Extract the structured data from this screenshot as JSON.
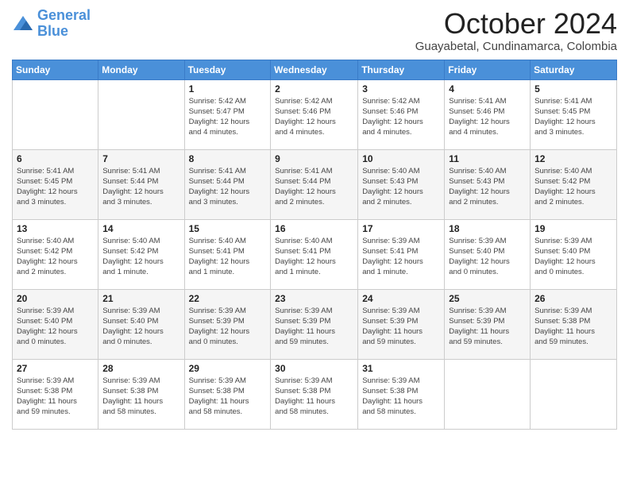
{
  "logo": {
    "line1": "General",
    "line2": "Blue"
  },
  "title": "October 2024",
  "subtitle": "Guayabetal, Cundinamarca, Colombia",
  "days_of_week": [
    "Sunday",
    "Monday",
    "Tuesday",
    "Wednesday",
    "Thursday",
    "Friday",
    "Saturday"
  ],
  "weeks": [
    [
      {
        "day": "",
        "info": ""
      },
      {
        "day": "",
        "info": ""
      },
      {
        "day": "1",
        "info": "Sunrise: 5:42 AM\nSunset: 5:47 PM\nDaylight: 12 hours\nand 4 minutes."
      },
      {
        "day": "2",
        "info": "Sunrise: 5:42 AM\nSunset: 5:46 PM\nDaylight: 12 hours\nand 4 minutes."
      },
      {
        "day": "3",
        "info": "Sunrise: 5:42 AM\nSunset: 5:46 PM\nDaylight: 12 hours\nand 4 minutes."
      },
      {
        "day": "4",
        "info": "Sunrise: 5:41 AM\nSunset: 5:46 PM\nDaylight: 12 hours\nand 4 minutes."
      },
      {
        "day": "5",
        "info": "Sunrise: 5:41 AM\nSunset: 5:45 PM\nDaylight: 12 hours\nand 3 minutes."
      }
    ],
    [
      {
        "day": "6",
        "info": "Sunrise: 5:41 AM\nSunset: 5:45 PM\nDaylight: 12 hours\nand 3 minutes."
      },
      {
        "day": "7",
        "info": "Sunrise: 5:41 AM\nSunset: 5:44 PM\nDaylight: 12 hours\nand 3 minutes."
      },
      {
        "day": "8",
        "info": "Sunrise: 5:41 AM\nSunset: 5:44 PM\nDaylight: 12 hours\nand 3 minutes."
      },
      {
        "day": "9",
        "info": "Sunrise: 5:41 AM\nSunset: 5:44 PM\nDaylight: 12 hours\nand 2 minutes."
      },
      {
        "day": "10",
        "info": "Sunrise: 5:40 AM\nSunset: 5:43 PM\nDaylight: 12 hours\nand 2 minutes."
      },
      {
        "day": "11",
        "info": "Sunrise: 5:40 AM\nSunset: 5:43 PM\nDaylight: 12 hours\nand 2 minutes."
      },
      {
        "day": "12",
        "info": "Sunrise: 5:40 AM\nSunset: 5:42 PM\nDaylight: 12 hours\nand 2 minutes."
      }
    ],
    [
      {
        "day": "13",
        "info": "Sunrise: 5:40 AM\nSunset: 5:42 PM\nDaylight: 12 hours\nand 2 minutes."
      },
      {
        "day": "14",
        "info": "Sunrise: 5:40 AM\nSunset: 5:42 PM\nDaylight: 12 hours\nand 1 minute."
      },
      {
        "day": "15",
        "info": "Sunrise: 5:40 AM\nSunset: 5:41 PM\nDaylight: 12 hours\nand 1 minute."
      },
      {
        "day": "16",
        "info": "Sunrise: 5:40 AM\nSunset: 5:41 PM\nDaylight: 12 hours\nand 1 minute."
      },
      {
        "day": "17",
        "info": "Sunrise: 5:39 AM\nSunset: 5:41 PM\nDaylight: 12 hours\nand 1 minute."
      },
      {
        "day": "18",
        "info": "Sunrise: 5:39 AM\nSunset: 5:40 PM\nDaylight: 12 hours\nand 0 minutes."
      },
      {
        "day": "19",
        "info": "Sunrise: 5:39 AM\nSunset: 5:40 PM\nDaylight: 12 hours\nand 0 minutes."
      }
    ],
    [
      {
        "day": "20",
        "info": "Sunrise: 5:39 AM\nSunset: 5:40 PM\nDaylight: 12 hours\nand 0 minutes."
      },
      {
        "day": "21",
        "info": "Sunrise: 5:39 AM\nSunset: 5:40 PM\nDaylight: 12 hours\nand 0 minutes."
      },
      {
        "day": "22",
        "info": "Sunrise: 5:39 AM\nSunset: 5:39 PM\nDaylight: 12 hours\nand 0 minutes."
      },
      {
        "day": "23",
        "info": "Sunrise: 5:39 AM\nSunset: 5:39 PM\nDaylight: 11 hours\nand 59 minutes."
      },
      {
        "day": "24",
        "info": "Sunrise: 5:39 AM\nSunset: 5:39 PM\nDaylight: 11 hours\nand 59 minutes."
      },
      {
        "day": "25",
        "info": "Sunrise: 5:39 AM\nSunset: 5:39 PM\nDaylight: 11 hours\nand 59 minutes."
      },
      {
        "day": "26",
        "info": "Sunrise: 5:39 AM\nSunset: 5:38 PM\nDaylight: 11 hours\nand 59 minutes."
      }
    ],
    [
      {
        "day": "27",
        "info": "Sunrise: 5:39 AM\nSunset: 5:38 PM\nDaylight: 11 hours\nand 59 minutes."
      },
      {
        "day": "28",
        "info": "Sunrise: 5:39 AM\nSunset: 5:38 PM\nDaylight: 11 hours\nand 58 minutes."
      },
      {
        "day": "29",
        "info": "Sunrise: 5:39 AM\nSunset: 5:38 PM\nDaylight: 11 hours\nand 58 minutes."
      },
      {
        "day": "30",
        "info": "Sunrise: 5:39 AM\nSunset: 5:38 PM\nDaylight: 11 hours\nand 58 minutes."
      },
      {
        "day": "31",
        "info": "Sunrise: 5:39 AM\nSunset: 5:38 PM\nDaylight: 11 hours\nand 58 minutes."
      },
      {
        "day": "",
        "info": ""
      },
      {
        "day": "",
        "info": ""
      }
    ]
  ]
}
